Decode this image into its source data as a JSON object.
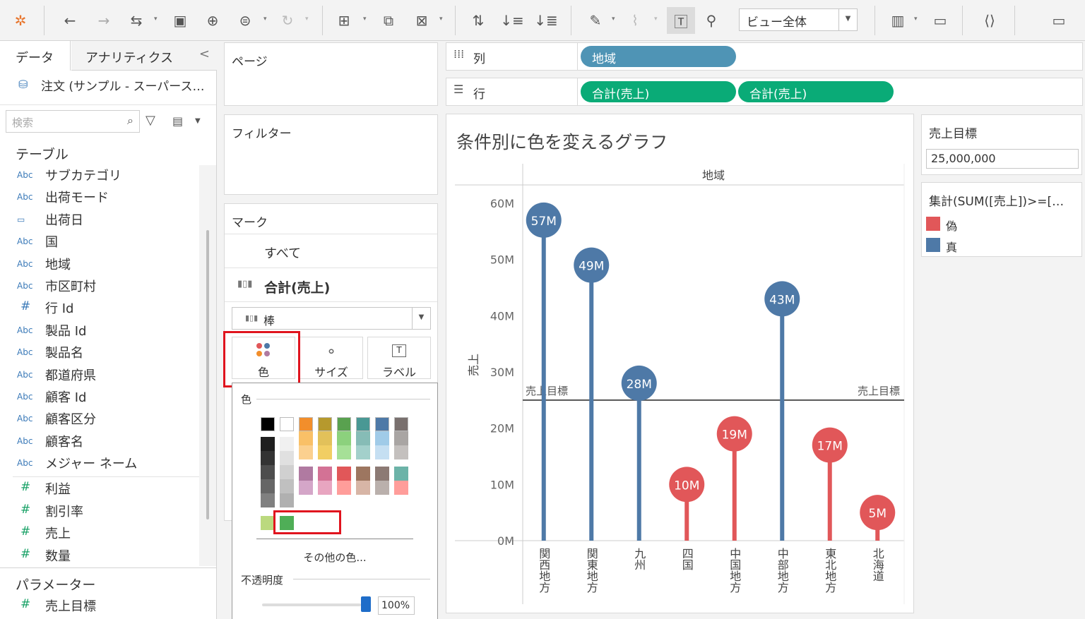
{
  "toolbar": {
    "icons": [
      "tableau-logo-icon",
      "undo-icon",
      "redo-icon",
      "swap-icon",
      "save-icon",
      "new-datasource-icon",
      "datasource-icon",
      "refresh-icon",
      "new-worksheet-icon",
      "duplicate-icon",
      "clear-icon",
      "swap-rows-icon",
      "sort-asc-icon",
      "sort-desc-icon",
      "highlight-icon",
      "attach-icon",
      "show-labels-icon",
      "pin-icon",
      "show-me-icon",
      "presentation-icon",
      "share-icon",
      "tooltip-icon"
    ],
    "view_select": "ビュー全体"
  },
  "left_panel": {
    "tabs": [
      "データ",
      "アナリティクス"
    ],
    "collapse": "<",
    "datasource": "注文 (サンプル - スーパース…",
    "search_placeholder": "検索",
    "tables_header": "テーブル",
    "dimensions": [
      {
        "type": "Abc",
        "label": "サブカテゴリ"
      },
      {
        "type": "date",
        "label": "出荷モード"
      },
      {
        "type": "date",
        "label": "出荷日"
      },
      {
        "type": "Abc",
        "label": "国"
      },
      {
        "type": "Abc",
        "label": "地域"
      },
      {
        "type": "Abc",
        "label": "市区町村"
      },
      {
        "type": "#",
        "label": "行 Id"
      },
      {
        "type": "Abc",
        "label": "製品 Id"
      },
      {
        "type": "Abc",
        "label": "製品名"
      },
      {
        "type": "Abc",
        "label": "都道府県"
      },
      {
        "type": "Abc",
        "label": "顧客 Id"
      },
      {
        "type": "Abc",
        "label": "顧客区分"
      },
      {
        "type": "Abc",
        "label": "顧客名"
      },
      {
        "type": "Abc",
        "label": "メジャー ネーム"
      }
    ],
    "measures": [
      "利益",
      "割引率",
      "売上",
      "数量"
    ],
    "parameters_header": "パラメーター",
    "parameters": [
      "売上目標"
    ]
  },
  "pages_shelf": {
    "label": "ページ"
  },
  "filters_shelf": {
    "label": "フィルター"
  },
  "marks": {
    "label": "マーク",
    "all": "すべて",
    "measure": "合計(売上)",
    "mark_type": "棒",
    "buttons": {
      "color": "色",
      "size": "サイズ",
      "label": "ラベル"
    }
  },
  "color_popup": {
    "title": "色",
    "more_colors": "その他の色...",
    "opacity_label": "不透明度",
    "opacity_value": "100%",
    "opacity": 1.0,
    "palette_top": [
      "#000000",
      "#ffffff",
      "#f28e2b",
      "#b6992d",
      "#59a14f",
      "#499894",
      "#4e79a7",
      "#79706e"
    ],
    "palette_cols": [
      [
        "#1f1f1f",
        "#333333",
        "#4d4d4d",
        "#666666",
        "#808080"
      ],
      [
        "#f0f0f0",
        "#e0e0e0",
        "#d0d0d0",
        "#c0c0c0",
        "#b0b0b0"
      ],
      [
        "#f6a54c",
        "#f9c067",
        "#fbd08f",
        "#b07aa1",
        "#d4a6c8"
      ],
      [
        "#c9a83a",
        "#e2c15a",
        "#f1ce63",
        "#d37295",
        "#e8a5c0"
      ],
      [
        "#6cb85e",
        "#8cd17d",
        "#a6e097",
        "#e15759",
        "#ff9d9a"
      ],
      [
        "#5fafa8",
        "#86bcb6",
        "#a3d0cb",
        "#9d7660",
        "#d7b5a6"
      ],
      [
        "#6a96c4",
        "#a0cbe8",
        "#c5dff2",
        "#8c7a74",
        "#bab0ac"
      ],
      [
        "#8e8a88",
        "#a9a5a3",
        "#c4c0be",
        "#6cb3a8",
        "#ff9d9a"
      ]
    ],
    "palette_extra": [
      "#bbd97e",
      "#4fae57"
    ]
  },
  "columns_shelf": {
    "label": "列",
    "pills": [
      "地域"
    ]
  },
  "rows_shelf": {
    "label": "行",
    "pills": [
      "合計(売上)",
      "合計(売上)"
    ]
  },
  "chart_data": {
    "type": "lollipop",
    "title": "条件別に色を変えるグラフ",
    "header": "地域",
    "ylabel": "売上",
    "ylim": [
      0,
      60000000
    ],
    "yticks": [
      "0M",
      "10M",
      "20M",
      "30M",
      "40M",
      "50M",
      "60M"
    ],
    "categories": [
      "関西地方",
      "関東地方",
      "九州",
      "四国",
      "中国地方",
      "中部地方",
      "東北地方",
      "北海道"
    ],
    "values": [
      57000000,
      49000000,
      28000000,
      10000000,
      19000000,
      43000000,
      17000000,
      5000000
    ],
    "labels": [
      "57M",
      "49M",
      "28M",
      "10M",
      "19M",
      "43M",
      "17M",
      "5M"
    ],
    "reference_line": {
      "value": 25000000,
      "label": "売上目標"
    },
    "colors": {
      "true": "#4e79a7",
      "false": "#e15759"
    }
  },
  "parameter_card": {
    "title": "売上目標",
    "value": "25,000,000"
  },
  "legend": {
    "title": "集計(SUM([売上])>=[…",
    "items": [
      {
        "label": "偽",
        "color": "#e15759"
      },
      {
        "label": "真",
        "color": "#4e79a7"
      }
    ]
  }
}
